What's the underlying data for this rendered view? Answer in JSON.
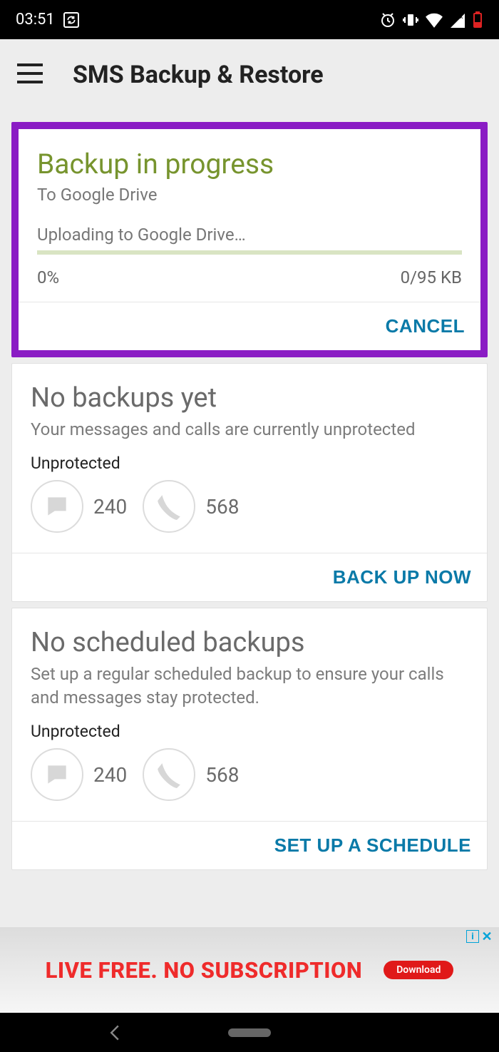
{
  "status": {
    "time": "03:51"
  },
  "app": {
    "title": "SMS Backup & Restore"
  },
  "progress": {
    "title": "Backup in progress",
    "destination": "To Google Drive",
    "status": "Uploading to Google Drive…",
    "percent": "0%",
    "bytes": "0/95 KB",
    "cancel": "CANCEL"
  },
  "backups": {
    "title": "No backups yet",
    "desc": "Your messages and calls are currently unprotected",
    "label": "Unprotected",
    "messages": "240",
    "calls": "568",
    "action": "BACK UP NOW"
  },
  "schedule": {
    "title": "No scheduled backups",
    "desc": "Set up a regular scheduled backup to ensure your calls and messages stay protected.",
    "label": "Unprotected",
    "messages": "240",
    "calls": "568",
    "action": "SET UP A SCHEDULE"
  },
  "ad": {
    "text": "LIVE FREE. NO SUBSCRIPTION",
    "button": "Download"
  }
}
